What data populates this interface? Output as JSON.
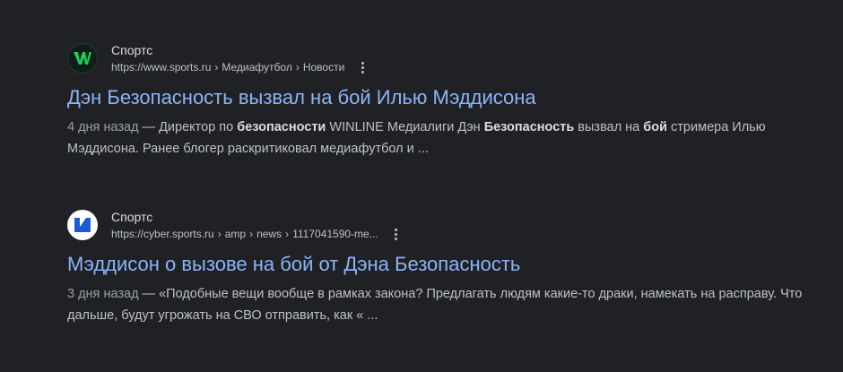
{
  "results": [
    {
      "site_name": "Спортс",
      "favicon_icon": "sports-ru-green-logo-icon",
      "url": "https://www.sports.ru",
      "breadcrumbs": [
        "Медиафутбол",
        "Новости"
      ],
      "title": "Дэн Безопасность вызвал на бой Илью Мэддисона",
      "date": "4 дня назад",
      "snippet_parts": [
        {
          "text": " — Директор по ",
          "bold": false
        },
        {
          "text": "безопасности",
          "bold": true
        },
        {
          "text": " WINLINE Медиалиги Дэн ",
          "bold": false
        },
        {
          "text": "Безопасность",
          "bold": true
        },
        {
          "text": " вызвал на ",
          "bold": false
        },
        {
          "text": "бой",
          "bold": true
        },
        {
          "text": " стримера Илью Мэддисона. Ранее блогер раскритиковал медиафутбол и ...",
          "bold": false
        }
      ]
    },
    {
      "site_name": "Спортс",
      "favicon_icon": "cyber-sports-logo-icon",
      "url": "https://cyber.sports.ru",
      "breadcrumbs": [
        "amp",
        "news",
        "1117041590-me..."
      ],
      "title": "Мэддисон о вызове на бой от Дэна Безопасность",
      "date": "3 дня назад",
      "snippet_parts": [
        {
          "text": " — «Подобные вещи вообще в рамках закона? Предлагать людям какие-то драки, намекать на расправу. Что дальше, будут угрожать на СВО отправить, как « ...",
          "bold": false
        }
      ]
    }
  ],
  "crumb_separator": "›",
  "colors": {
    "background": "#202124",
    "title_link": "#8ab4f8",
    "text": "#bdc1c6",
    "favicon_green": "#1fcc5c",
    "favicon_blue": "#1d5bd6"
  }
}
